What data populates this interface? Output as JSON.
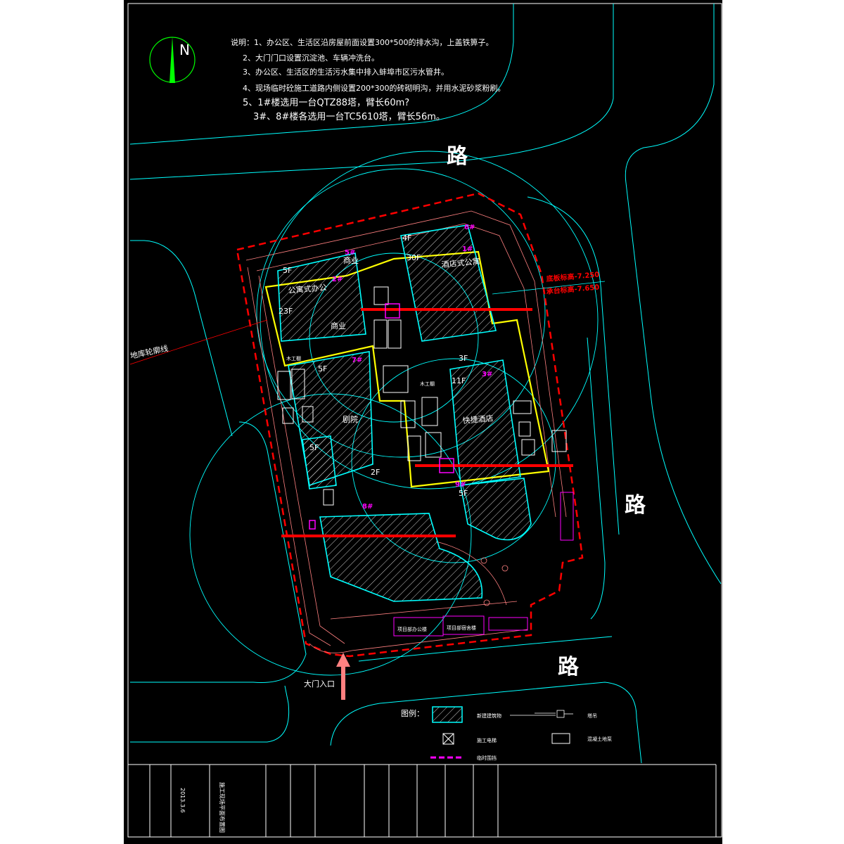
{
  "notes": {
    "line1": "说明：1、办公区、生活区沿房屋前面设置300*500的排水沟，上盖铁箅子。",
    "line2": "2、大门门口设置沉淀池、车辆冲洗台。",
    "line3": "3、办公区、生活区的生活污水集中排入蚌埠市区污水管井。",
    "line4": "4、现场临时砼施工道路内侧设置200*300的砖砌明沟，并用水泥砂浆粉刷。",
    "line5": "5、1#楼选用一台QTZ88塔，臂长60m?",
    "line6": "3#、8#楼各选用一台TC5610塔，臂长56m。"
  },
  "compass": {
    "letter": "N"
  },
  "roads": {
    "north": "路",
    "east": "路",
    "south": "路"
  },
  "labels": {
    "basement_outline": "地库轮廓线",
    "entrance": "大门入口",
    "depth1": "底板标高-7.250",
    "depth2": "承台标高-7.650",
    "commercial1": "商业",
    "commercial2": "商业",
    "office_apartment": "公寓式办公",
    "residential_apartment": "酒店式公寓",
    "theater": "剧院",
    "express_hotel": "快捷酒店",
    "carpentry1": "木工棚",
    "carpentry2": "木工棚",
    "project_office": "项目部办公楼",
    "project_dorm": "项目部宿舍楼",
    "floors_30f": "30F",
    "floors_23f": "23F",
    "floors_5f_a": "5F",
    "floors_5f_b": "5F",
    "floors_5f_c": "5F",
    "floors_4f": "4F",
    "floors_3f": "3F",
    "floors_11f": "11F",
    "floors_2f": "2F",
    "floors_5f_d": "5F",
    "bldg_1": "1#",
    "bldg_5": "5#",
    "bldg_6": "6#",
    "bldg_2": "2#",
    "bldg_7": "7#",
    "bldg_3": "3#",
    "bldg_8": "8#",
    "bldg_9": "9#"
  },
  "legend": {
    "title": "图例：",
    "new_building": "新建建筑物",
    "tower_crane": "塔吊",
    "construction_elevator": "施工电梯",
    "concrete_pump": "混凝土地泵",
    "temp_fence": "临时围挡"
  },
  "title_block": {
    "date": "2013.3.6",
    "drawing_name": "施工现场平面布置图"
  },
  "colors": {
    "background": "#000000",
    "cyan": "#00ffff",
    "yellow": "#ffff00",
    "red": "#ff0000",
    "magenta": "#ff00ff",
    "green": "#00ff00",
    "salmon": "#ff8080"
  }
}
